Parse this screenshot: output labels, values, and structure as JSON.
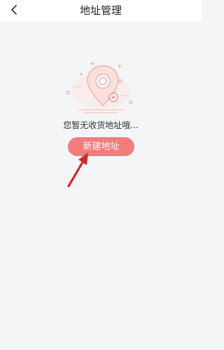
{
  "header": {
    "title": "地址管理",
    "back_icon": "chevron-left-icon"
  },
  "empty_state": {
    "message": "您暂无收货地址哦...",
    "illustration_icon": "map-pin-icon",
    "accent_color": "#f47c7c"
  },
  "actions": {
    "add_address_label": "新建地址"
  }
}
